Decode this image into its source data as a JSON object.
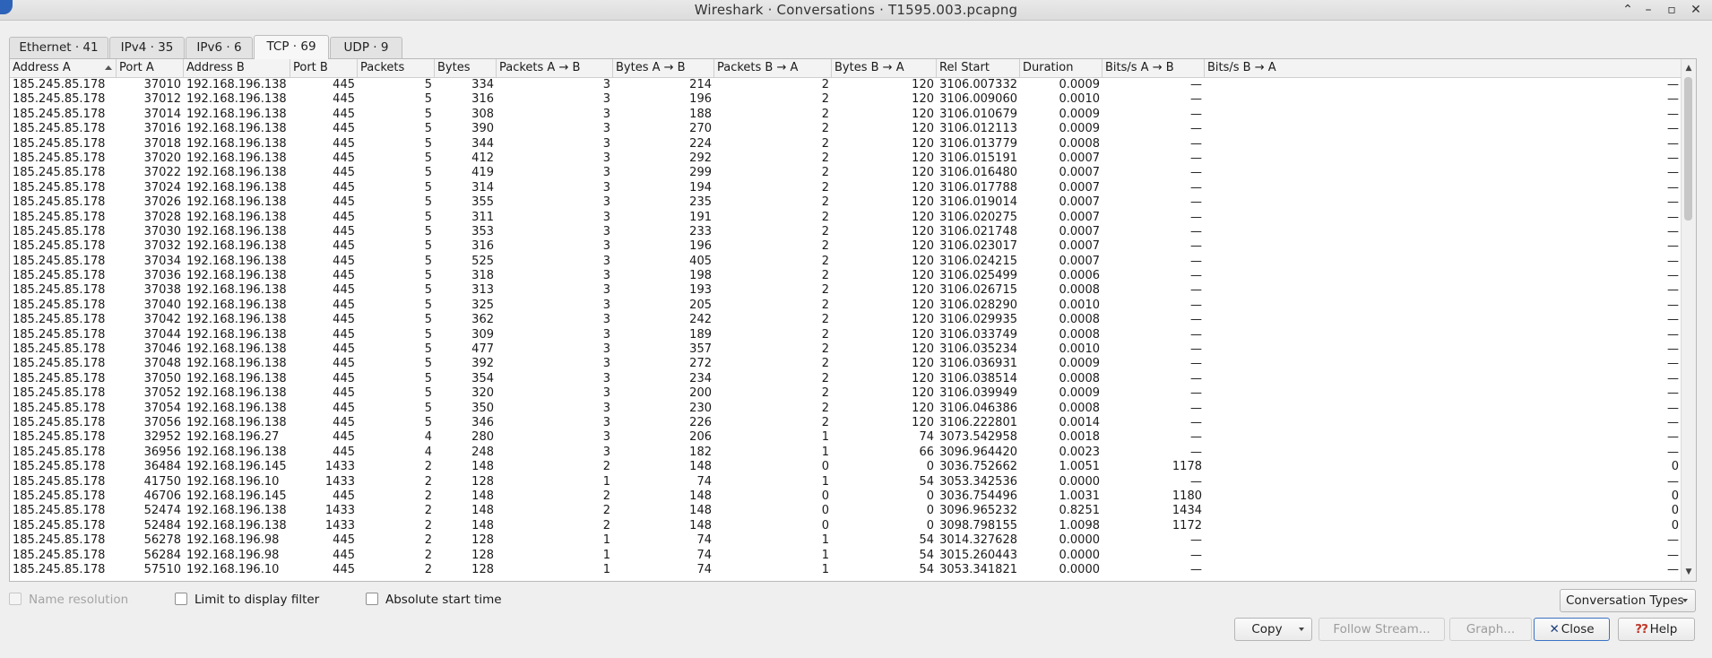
{
  "window": {
    "title": "Wireshark · Conversations · T1595.003.pcapng",
    "buttons": [
      "⌃",
      "–",
      "▫",
      "✕"
    ]
  },
  "tabs": [
    {
      "label": "Ethernet · 41"
    },
    {
      "label": "IPv4 · 35"
    },
    {
      "label": "IPv6 · 6"
    },
    {
      "label": "TCP · 69",
      "active": true
    },
    {
      "label": "UDP · 9"
    }
  ],
  "table": {
    "columns": [
      "Address A",
      "Port A",
      "Address B",
      "Port B",
      "Packets",
      "Bytes",
      "Packets A → B",
      "Bytes A → B",
      "Packets B → A",
      "Bytes B → A",
      "Rel Start",
      "Duration",
      "Bits/s A → B",
      "Bits/s B → A"
    ],
    "sorted_column": "Address A",
    "rows": [
      [
        "185.245.85.178",
        "37010",
        "192.168.196.138",
        "445",
        "5",
        "334",
        "3",
        "214",
        "2",
        "120",
        "3106.007332",
        "0.0009",
        "—",
        "—"
      ],
      [
        "185.245.85.178",
        "37012",
        "192.168.196.138",
        "445",
        "5",
        "316",
        "3",
        "196",
        "2",
        "120",
        "3106.009060",
        "0.0010",
        "—",
        "—"
      ],
      [
        "185.245.85.178",
        "37014",
        "192.168.196.138",
        "445",
        "5",
        "308",
        "3",
        "188",
        "2",
        "120",
        "3106.010679",
        "0.0009",
        "—",
        "—"
      ],
      [
        "185.245.85.178",
        "37016",
        "192.168.196.138",
        "445",
        "5",
        "390",
        "3",
        "270",
        "2",
        "120",
        "3106.012113",
        "0.0009",
        "—",
        "—"
      ],
      [
        "185.245.85.178",
        "37018",
        "192.168.196.138",
        "445",
        "5",
        "344",
        "3",
        "224",
        "2",
        "120",
        "3106.013779",
        "0.0008",
        "—",
        "—"
      ],
      [
        "185.245.85.178",
        "37020",
        "192.168.196.138",
        "445",
        "5",
        "412",
        "3",
        "292",
        "2",
        "120",
        "3106.015191",
        "0.0007",
        "—",
        "—"
      ],
      [
        "185.245.85.178",
        "37022",
        "192.168.196.138",
        "445",
        "5",
        "419",
        "3",
        "299",
        "2",
        "120",
        "3106.016480",
        "0.0007",
        "—",
        "—"
      ],
      [
        "185.245.85.178",
        "37024",
        "192.168.196.138",
        "445",
        "5",
        "314",
        "3",
        "194",
        "2",
        "120",
        "3106.017788",
        "0.0007",
        "—",
        "—"
      ],
      [
        "185.245.85.178",
        "37026",
        "192.168.196.138",
        "445",
        "5",
        "355",
        "3",
        "235",
        "2",
        "120",
        "3106.019014",
        "0.0007",
        "—",
        "—"
      ],
      [
        "185.245.85.178",
        "37028",
        "192.168.196.138",
        "445",
        "5",
        "311",
        "3",
        "191",
        "2",
        "120",
        "3106.020275",
        "0.0007",
        "—",
        "—"
      ],
      [
        "185.245.85.178",
        "37030",
        "192.168.196.138",
        "445",
        "5",
        "353",
        "3",
        "233",
        "2",
        "120",
        "3106.021748",
        "0.0007",
        "—",
        "—"
      ],
      [
        "185.245.85.178",
        "37032",
        "192.168.196.138",
        "445",
        "5",
        "316",
        "3",
        "196",
        "2",
        "120",
        "3106.023017",
        "0.0007",
        "—",
        "—"
      ],
      [
        "185.245.85.178",
        "37034",
        "192.168.196.138",
        "445",
        "5",
        "525",
        "3",
        "405",
        "2",
        "120",
        "3106.024215",
        "0.0007",
        "—",
        "—"
      ],
      [
        "185.245.85.178",
        "37036",
        "192.168.196.138",
        "445",
        "5",
        "318",
        "3",
        "198",
        "2",
        "120",
        "3106.025499",
        "0.0006",
        "—",
        "—"
      ],
      [
        "185.245.85.178",
        "37038",
        "192.168.196.138",
        "445",
        "5",
        "313",
        "3",
        "193",
        "2",
        "120",
        "3106.026715",
        "0.0008",
        "—",
        "—"
      ],
      [
        "185.245.85.178",
        "37040",
        "192.168.196.138",
        "445",
        "5",
        "325",
        "3",
        "205",
        "2",
        "120",
        "3106.028290",
        "0.0010",
        "—",
        "—"
      ],
      [
        "185.245.85.178",
        "37042",
        "192.168.196.138",
        "445",
        "5",
        "362",
        "3",
        "242",
        "2",
        "120",
        "3106.029935",
        "0.0008",
        "—",
        "—"
      ],
      [
        "185.245.85.178",
        "37044",
        "192.168.196.138",
        "445",
        "5",
        "309",
        "3",
        "189",
        "2",
        "120",
        "3106.033749",
        "0.0008",
        "—",
        "—"
      ],
      [
        "185.245.85.178",
        "37046",
        "192.168.196.138",
        "445",
        "5",
        "477",
        "3",
        "357",
        "2",
        "120",
        "3106.035234",
        "0.0010",
        "—",
        "—"
      ],
      [
        "185.245.85.178",
        "37048",
        "192.168.196.138",
        "445",
        "5",
        "392",
        "3",
        "272",
        "2",
        "120",
        "3106.036931",
        "0.0009",
        "—",
        "—"
      ],
      [
        "185.245.85.178",
        "37050",
        "192.168.196.138",
        "445",
        "5",
        "354",
        "3",
        "234",
        "2",
        "120",
        "3106.038514",
        "0.0008",
        "—",
        "—"
      ],
      [
        "185.245.85.178",
        "37052",
        "192.168.196.138",
        "445",
        "5",
        "320",
        "3",
        "200",
        "2",
        "120",
        "3106.039949",
        "0.0009",
        "—",
        "—"
      ],
      [
        "185.245.85.178",
        "37054",
        "192.168.196.138",
        "445",
        "5",
        "350",
        "3",
        "230",
        "2",
        "120",
        "3106.046386",
        "0.0008",
        "—",
        "—"
      ],
      [
        "185.245.85.178",
        "37056",
        "192.168.196.138",
        "445",
        "5",
        "346",
        "3",
        "226",
        "2",
        "120",
        "3106.222801",
        "0.0014",
        "—",
        "—"
      ],
      [
        "185.245.85.178",
        "32952",
        "192.168.196.27",
        "445",
        "4",
        "280",
        "3",
        "206",
        "1",
        "74",
        "3073.542958",
        "0.0018",
        "—",
        "—"
      ],
      [
        "185.245.85.178",
        "36956",
        "192.168.196.138",
        "445",
        "4",
        "248",
        "3",
        "182",
        "1",
        "66",
        "3096.964420",
        "0.0023",
        "—",
        "—"
      ],
      [
        "185.245.85.178",
        "36484",
        "192.168.196.145",
        "1433",
        "2",
        "148",
        "2",
        "148",
        "0",
        "0",
        "3036.752662",
        "1.0051",
        "1178",
        "0"
      ],
      [
        "185.245.85.178",
        "41750",
        "192.168.196.10",
        "1433",
        "2",
        "128",
        "1",
        "74",
        "1",
        "54",
        "3053.342536",
        "0.0000",
        "—",
        "—"
      ],
      [
        "185.245.85.178",
        "46706",
        "192.168.196.145",
        "445",
        "2",
        "148",
        "2",
        "148",
        "0",
        "0",
        "3036.754496",
        "1.0031",
        "1180",
        "0"
      ],
      [
        "185.245.85.178",
        "52474",
        "192.168.196.138",
        "1433",
        "2",
        "148",
        "2",
        "148",
        "0",
        "0",
        "3096.965232",
        "0.8251",
        "1434",
        "0"
      ],
      [
        "185.245.85.178",
        "52484",
        "192.168.196.138",
        "1433",
        "2",
        "148",
        "2",
        "148",
        "0",
        "0",
        "3098.798155",
        "1.0098",
        "1172",
        "0"
      ],
      [
        "185.245.85.178",
        "56278",
        "192.168.196.98",
        "445",
        "2",
        "128",
        "1",
        "74",
        "1",
        "54",
        "3014.327628",
        "0.0000",
        "—",
        "—"
      ],
      [
        "185.245.85.178",
        "56284",
        "192.168.196.98",
        "445",
        "2",
        "128",
        "1",
        "74",
        "1",
        "54",
        "3015.260443",
        "0.0000",
        "—",
        "—"
      ],
      [
        "185.245.85.178",
        "57510",
        "192.168.196.10",
        "445",
        "2",
        "128",
        "1",
        "74",
        "1",
        "54",
        "3053.341821",
        "0.0000",
        "—",
        "—"
      ]
    ]
  },
  "options": {
    "name_resolution": "Name resolution",
    "limit_filter": "Limit to display filter",
    "absolute_start": "Absolute start time"
  },
  "buttons": {
    "conversation_types": "Conversation Types",
    "copy": "Copy",
    "follow_stream": "Follow Stream...",
    "graph": "Graph...",
    "close": "Close",
    "help": "Help"
  }
}
